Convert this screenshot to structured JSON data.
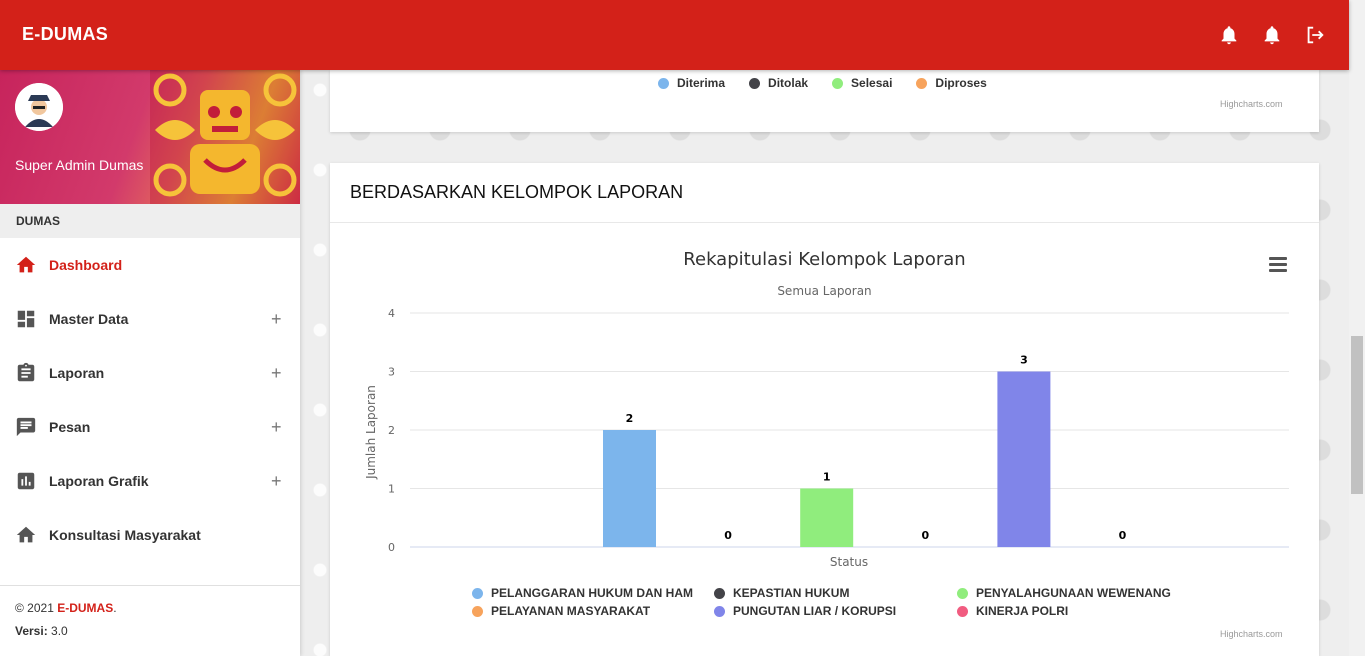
{
  "app": {
    "brand": "E-DUMAS"
  },
  "header": {
    "icons": [
      "bell-icon",
      "bell-icon",
      "logout-icon"
    ]
  },
  "user": {
    "name": "Super Admin Dumas"
  },
  "sidebar": {
    "section": "DUMAS",
    "items": [
      {
        "label": "Dashboard",
        "icon": "home-icon",
        "expandable": false,
        "active": true
      },
      {
        "label": "Master Data",
        "icon": "dashboard-tiles-icon",
        "expandable": true,
        "plus": "+"
      },
      {
        "label": "Laporan",
        "icon": "clipboard-icon",
        "expandable": true,
        "plus": "+"
      },
      {
        "label": "Pesan",
        "icon": "message-icon",
        "expandable": true,
        "plus": "+"
      },
      {
        "label": "Laporan Grafik",
        "icon": "bar-chart-icon",
        "expandable": true,
        "plus": "+"
      },
      {
        "label": "Konsultasi Masyarakat",
        "icon": "home-icon",
        "expandable": false
      }
    ],
    "footer": {
      "copyright": "© 2021 ",
      "brand": "E-DUMAS",
      "dot": ".",
      "version_label": "Versi:",
      "version_value": " 3.0"
    }
  },
  "status_card": {
    "legend": [
      {
        "label": "Diterima",
        "color": "#7cb5ec"
      },
      {
        "label": "Ditolak",
        "color": "#434348"
      },
      {
        "label": "Selesai",
        "color": "#90ed7d"
      },
      {
        "label": "Diproses",
        "color": "#f7a35c"
      }
    ],
    "credits": "Highcharts.com"
  },
  "group_card": {
    "header": "BERDASARKAN KELOMPOK LAPORAN",
    "credits": "Highcharts.com"
  },
  "chart_data": {
    "type": "bar",
    "title": "Rekapitulasi Kelompok Laporan",
    "subtitle": "Semua Laporan",
    "xlabel": "Status",
    "ylabel": "Jumlah Laporan",
    "ylim": [
      0,
      4
    ],
    "yticks": [
      "0",
      "1",
      "2",
      "3",
      "4"
    ],
    "grid": true,
    "legend_position": "bottom",
    "series": [
      {
        "name": "PELANGGARAN HUKUM DAN HAM",
        "value": 2,
        "color": "#7cb5ec"
      },
      {
        "name": "KEPASTIAN HUKUM",
        "value": 0,
        "color": "#434348"
      },
      {
        "name": "PENYALAHGUNAAN WEWENANG",
        "value": 1,
        "color": "#90ed7d"
      },
      {
        "name": "PELAYANAN MASYARAKAT",
        "value": 0,
        "color": "#f7a35c"
      },
      {
        "name": "PUNGUTAN LIAR / KORUPSI",
        "value": 3,
        "color": "#8085e9"
      },
      {
        "name": "KINERJA POLRI",
        "value": 0,
        "color": "#f15c80"
      }
    ]
  }
}
